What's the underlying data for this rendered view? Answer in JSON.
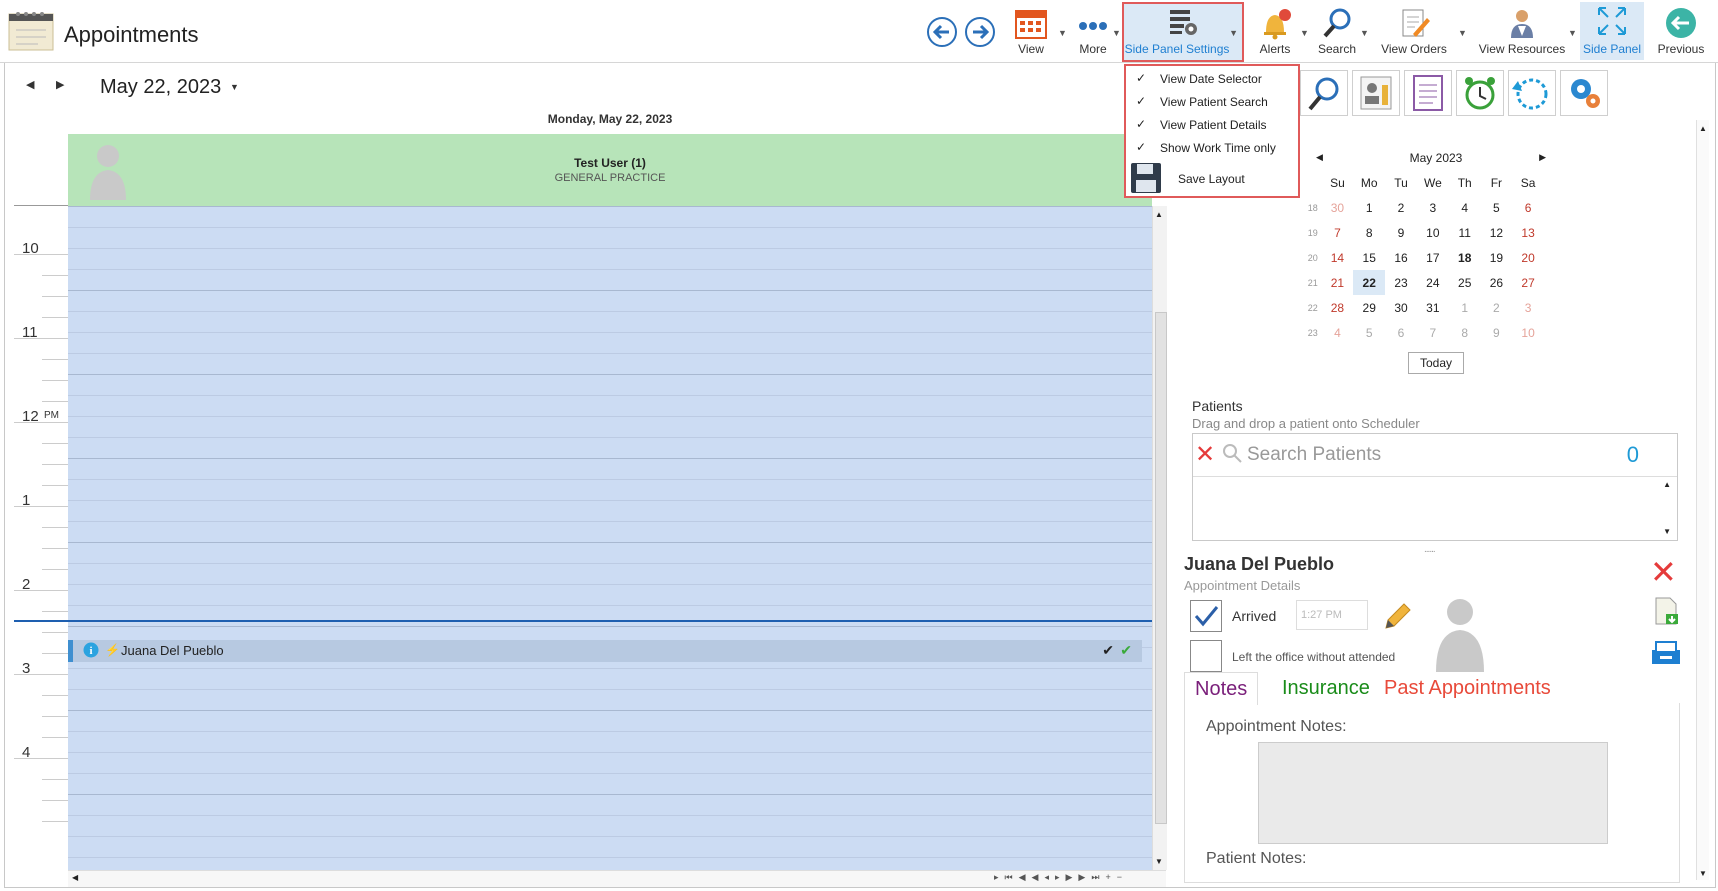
{
  "window": {
    "title": "Appointments"
  },
  "toolbar": {
    "view": "View",
    "more": "More",
    "side_panel_settings": "Side Panel Settings",
    "alerts": "Alerts",
    "search": "Search",
    "view_orders": "View Orders",
    "view_resources": "View Resources",
    "side_panel": "Side Panel",
    "previous": "Previous"
  },
  "side_panel_menu": {
    "items": [
      {
        "label": "View Date Selector",
        "checked": true
      },
      {
        "label": "View Patient Search",
        "checked": true
      },
      {
        "label": "View Patient Details",
        "checked": true
      },
      {
        "label": "Show Work Time only",
        "checked": true
      },
      {
        "label": "Save Layout",
        "checked": false
      }
    ]
  },
  "date_nav": {
    "current_date": "May 22, 2023"
  },
  "scheduler": {
    "day_header": "Monday, May 22, 2023",
    "resource_name": "Test User (1)",
    "resource_dept": "GENERAL PRACTICE",
    "hours": [
      "10",
      "11",
      "12",
      "1",
      "2",
      "3",
      "4"
    ],
    "pm_label": "PM",
    "appointment": {
      "patient": "Juana Del Pueblo"
    }
  },
  "calendar": {
    "month_title": "May 2023",
    "weekdays": [
      "Su",
      "Mo",
      "Tu",
      "We",
      "Th",
      "Fr",
      "Sa"
    ],
    "weeks": [
      {
        "wk": "18",
        "days": [
          "30",
          "1",
          "2",
          "3",
          "4",
          "5",
          "6"
        ]
      },
      {
        "wk": "19",
        "days": [
          "7",
          "8",
          "9",
          "10",
          "11",
          "12",
          "13"
        ]
      },
      {
        "wk": "20",
        "days": [
          "14",
          "15",
          "16",
          "17",
          "18",
          "19",
          "20"
        ]
      },
      {
        "wk": "21",
        "days": [
          "21",
          "22",
          "23",
          "24",
          "25",
          "26",
          "27"
        ]
      },
      {
        "wk": "22",
        "days": [
          "28",
          "29",
          "30",
          "31",
          "1",
          "2",
          "3"
        ]
      },
      {
        "wk": "23",
        "days": [
          "4",
          "5",
          "6",
          "7",
          "8",
          "9",
          "10"
        ]
      }
    ],
    "today_label": "Today"
  },
  "patients": {
    "title": "Patients",
    "subtitle": "Drag and drop a patient onto Scheduler",
    "search_placeholder": "Search Patients",
    "count": "0"
  },
  "details": {
    "patient_name": "Juana Del Pueblo",
    "subtitle": "Appointment Details",
    "arrived_label": "Arrived",
    "arrived_time": "1:27 PM",
    "left_label": "Left the office without attended"
  },
  "tabs": {
    "notes": "Notes",
    "insurance": "Insurance",
    "past": "Past Appointments"
  },
  "notes": {
    "appointment_label": "Appointment Notes:",
    "patient_label": "Patient Notes:"
  },
  "colors": {
    "accent": "#1e7fd1",
    "grid": "#ccdcf3",
    "resource": "#b7e4b9",
    "highlight_red": "#e05a5a"
  }
}
